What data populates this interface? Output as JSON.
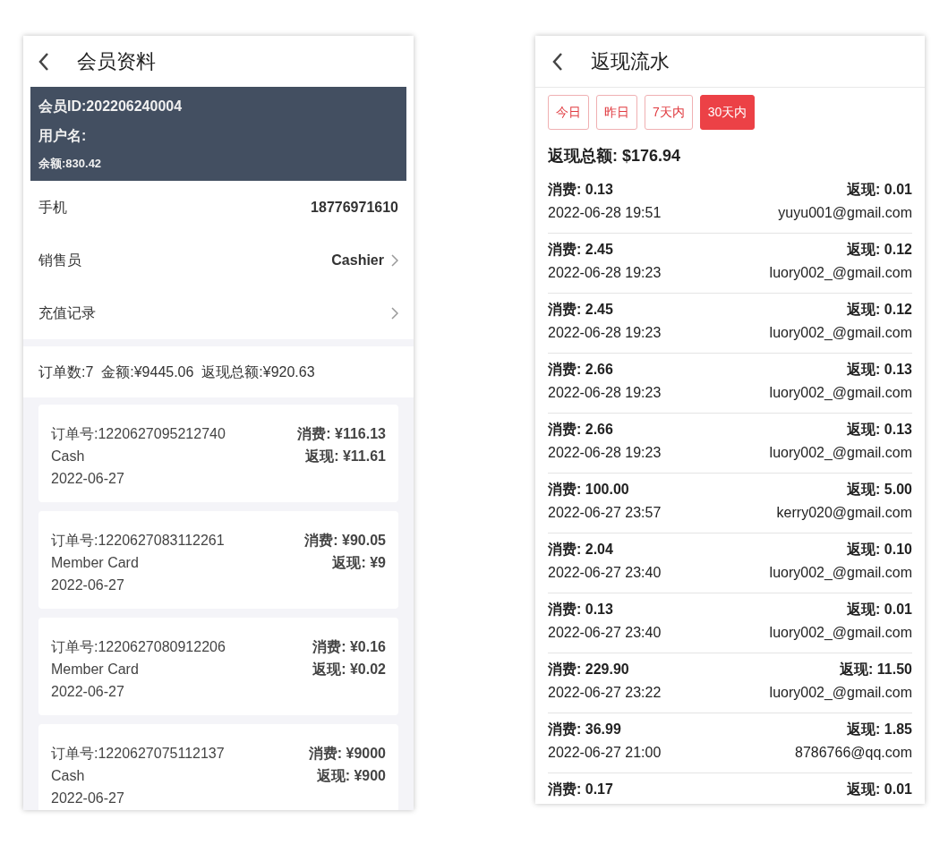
{
  "member_screen": {
    "title": "会员资料",
    "member_card": {
      "member_id": "会员ID:202206240004",
      "username": "用户名:",
      "balance": "余额:830.42"
    },
    "info_rows": [
      {
        "kind": "text",
        "label": "手机",
        "value": "18776971610"
      },
      {
        "kind": "link",
        "label": "销售员",
        "value": "Cashier"
      },
      {
        "kind": "link",
        "label": "充值记录"
      }
    ],
    "summary": "订单数:7  金额:¥9445.06  返现总额:¥920.63",
    "orders": [
      {
        "order_no": "订单号:1220627095212740",
        "payment": "Cash",
        "date": "2022-06-27",
        "spend": "消费: ¥116.13",
        "rebate": "返现: ¥11.61"
      },
      {
        "order_no": "订单号:1220627083112261",
        "payment": "Member Card",
        "date": "2022-06-27",
        "spend": "消费: ¥90.05",
        "rebate": "返现: ¥9"
      },
      {
        "order_no": "订单号:1220627080912206",
        "payment": "Member Card",
        "date": "2022-06-27",
        "spend": "消费: ¥0.16",
        "rebate": "返现: ¥0.02"
      },
      {
        "order_no": "订单号:1220627075112137",
        "payment": "Cash",
        "date": "2022-06-27",
        "spend": "消费: ¥9000",
        "rebate": "返现: ¥900"
      }
    ]
  },
  "cashback_screen": {
    "title": "返现流水",
    "filters": [
      {
        "label": "今日",
        "selected": false
      },
      {
        "label": "昨日",
        "selected": false
      },
      {
        "label": "7天内",
        "selected": false
      },
      {
        "label": "30天内",
        "selected": true
      }
    ],
    "total": "返现总额: $176.94",
    "records": [
      {
        "spend": "消费: 0.13",
        "rebate": "返现: 0.01",
        "time": "2022-06-28 19:51",
        "email": "yuyu001@gmail.com"
      },
      {
        "spend": "消费: 2.45",
        "rebate": "返现: 0.12",
        "time": "2022-06-28 19:23",
        "email": "luory002_@gmail.com"
      },
      {
        "spend": "消费: 2.45",
        "rebate": "返现: 0.12",
        "time": "2022-06-28 19:23",
        "email": "luory002_@gmail.com"
      },
      {
        "spend": "消费: 2.66",
        "rebate": "返现: 0.13",
        "time": "2022-06-28 19:23",
        "email": "luory002_@gmail.com"
      },
      {
        "spend": "消费: 2.66",
        "rebate": "返现: 0.13",
        "time": "2022-06-28 19:23",
        "email": "luory002_@gmail.com"
      },
      {
        "spend": "消费: 100.00",
        "rebate": "返现: 5.00",
        "time": "2022-06-27 23:57",
        "email": "kerry020@gmail.com"
      },
      {
        "spend": "消费: 2.04",
        "rebate": "返现: 0.10",
        "time": "2022-06-27 23:40",
        "email": "luory002_@gmail.com"
      },
      {
        "spend": "消费: 0.13",
        "rebate": "返现: 0.01",
        "time": "2022-06-27 23:40",
        "email": "luory002_@gmail.com"
      },
      {
        "spend": "消费: 229.90",
        "rebate": "返现: 11.50",
        "time": "2022-06-27 23:22",
        "email": "luory002_@gmail.com"
      },
      {
        "spend": "消费: 36.99",
        "rebate": "返现: 1.85",
        "time": "2022-06-27 21:00",
        "email": "8786766@qq.com"
      },
      {
        "spend": "消费: 0.17",
        "rebate": "返现: 0.01"
      }
    ]
  }
}
